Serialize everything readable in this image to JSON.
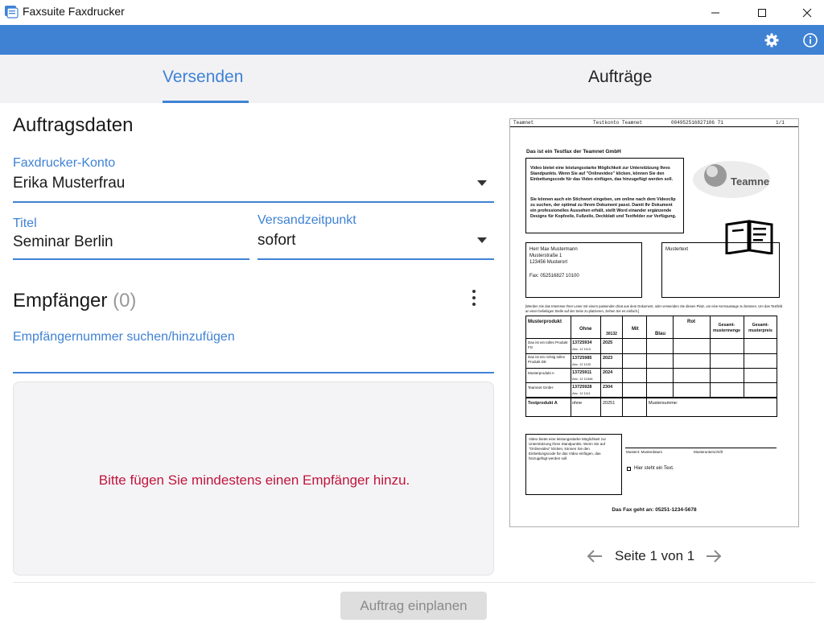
{
  "window": {
    "title": "Faxsuite Faxdrucker",
    "controls": [
      "minimize-icon",
      "maximize-icon",
      "close-icon"
    ]
  },
  "toolbar": {
    "icons": [
      "gear-icon",
      "info-icon"
    ],
    "color": "#3f82d4"
  },
  "tabs": [
    {
      "label": "Versenden",
      "active": true
    },
    {
      "label": "Aufträge",
      "active": false
    }
  ],
  "order": {
    "section_title": "Auftragsdaten",
    "account_label": "Faxdrucker-Konto",
    "account_value": "Erika Musterfrau",
    "title_label": "Titel",
    "title_value": "Seminar Berlin",
    "send_time_label": "Versandzeitpunkt",
    "send_time_value": "sofort"
  },
  "recipients": {
    "section_title": "Empfänger",
    "count": "(0)",
    "search_label": "Empfängernummer suchen/hinzufügen",
    "search_value": "",
    "empty_message": "Bitte fügen Sie mindestens einen Empfänger hinzu."
  },
  "preview": {
    "header_left": "Teamnet",
    "header_mid": "Testkonto Teamnet",
    "header_number": "004952516827106 71",
    "header_page": "1/1",
    "heading": "Das ist ein Testfax der Teamnet GmbH",
    "intro_p1": "Video bietet eine leistungsstarke Möglichkeit zur Unterstützung Ihres Standpunkts. Wenn Sie auf \"Onlinevideo\" klicken, können Sie den Einbettungscode für das Video einfügen, das hinzugefügt werden soll.",
    "intro_p2": "Sie können auch ein Stichwort eingeben, um online nach dem Videoclip zu suchen, der optimal zu Ihrem Dokument passt. Damit Ihr Dokument ein professionelles Aussehen erhält, stellt Word einander ergänzende Designs für Kopfzeile, Fußzeile, Deckblatt und Textfelder zur Verfügung.",
    "logo_text": "Teamne",
    "address": [
      "Herr Max Mustermann",
      "Musterstraße 1",
      "123456 Musterort",
      "",
      "Fax: 052516827 10100"
    ],
    "sample_text_label": "Mustertext",
    "note": "[Werden Sie das Interesse Ihrer Leser mit einem passenden Zitat aus dem Dokument, oder verwenden Sie diesen Platz, um eine Kernaussage zu betonen. Um das Textfeld an einer beliebigen Stelle auf der Seite zu platzieren, ziehen Sie es einfach.]",
    "table_headers": [
      "Musterprodukt",
      "Ohne",
      "30132",
      "Mit",
      "Blau",
      "Rot",
      "Gesamt-mustermenge",
      "Gesamt-musterpreis"
    ],
    "table_rows": [
      {
        "product": "Das ist ein tolles Produkt FG",
        "code": "13725934",
        "sub": "Abc. 12 1110",
        "year": "2025"
      },
      {
        "product": "Das ist ein richtig tolles Produkt DE",
        "code": "13725985",
        "sub": "Abc. 12 1120",
        "year": "2023"
      },
      {
        "product": "Musterprodukt A",
        "code": "13725911",
        "sub": "Abc. 12 11546",
        "year": "2024"
      },
      {
        "product": "Teamnet GmbH",
        "code": "13725928",
        "sub": "Abc. 12 1111",
        "year": "2304"
      }
    ],
    "summary_row": {
      "product": "Testprodukt A",
      "code": "ohne",
      "num": "20251",
      "label": "Mustersumme:"
    },
    "video_box_text": "Video bietet eine leistungsstarke Möglichkeit zur Unterstützung Ihres Standpunkts. Wenn Sie auf \"Onlinevideo\" klicken, können Sie den Einbettungscode für das Video einfügen, das hinzugefügt werden soll.",
    "sig_left": "Muster4: Musterdatum",
    "sig_right": "Musterunterschrift",
    "checkbox_text": "Hier steht ein Text.",
    "footer": "Das Fax geht an: 05251-1234-5678"
  },
  "pager": {
    "text": "Seite 1 von 1"
  },
  "actions": {
    "submit_label": "Auftrag einplanen"
  }
}
